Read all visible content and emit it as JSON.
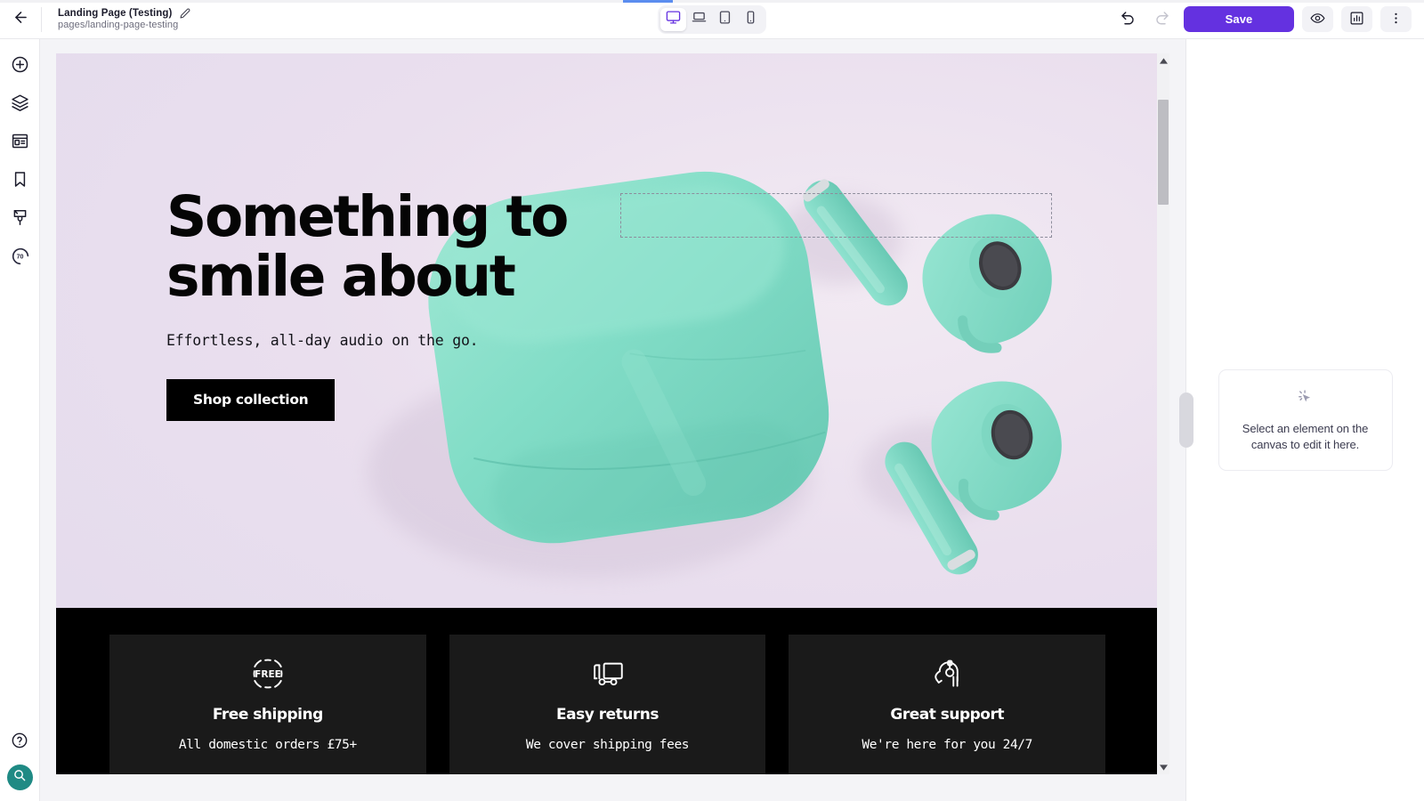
{
  "app": {
    "accent_purple": "#6431e0",
    "loadbar_color": "#5b8def",
    "teal_accent": "#1f8a84"
  },
  "topbar": {
    "back_icon": "arrow-left-icon",
    "page_title": "Landing Page (Testing)",
    "page_path": "pages/landing-page-testing",
    "edit_icon": "pencil-icon",
    "devices": [
      {
        "name": "desktop",
        "icon": "desktop-icon",
        "active": true
      },
      {
        "name": "laptop",
        "icon": "laptop-icon",
        "active": false
      },
      {
        "name": "tablet",
        "icon": "tablet-icon",
        "active": false
      },
      {
        "name": "mobile",
        "icon": "mobile-icon",
        "active": false
      }
    ],
    "undo_icon": "undo-icon",
    "redo_icon": "redo-icon",
    "save_label": "Save",
    "preview_icon": "eye-icon",
    "analytics_icon": "chart-icon",
    "more_icon": "more-vertical-icon"
  },
  "rail": {
    "items": [
      {
        "name": "add",
        "icon": "plus-circle-icon"
      },
      {
        "name": "layers",
        "icon": "layers-icon"
      },
      {
        "name": "sections",
        "icon": "template-icon"
      },
      {
        "name": "saved",
        "icon": "bookmark-icon"
      },
      {
        "name": "theme",
        "icon": "paint-brush-icon"
      },
      {
        "name": "score",
        "icon": "gauge-icon",
        "value": "70"
      }
    ],
    "help_icon": "help-circle-icon",
    "search_icon": "search-icon"
  },
  "canvas": {
    "hero": {
      "headline_line1": "Something to",
      "headline_line2": "smile about",
      "subtitle": "Effortless, all-day audio on the go.",
      "cta_label": "Shop collection",
      "background_color": "#ece2ee",
      "product_color": "#7fddc8",
      "drop_zone_label": "empty-drop-zone"
    },
    "features": [
      {
        "icon": "free-badge-icon",
        "icon_text": "FREE",
        "title": "Free shipping",
        "desc": "All domestic orders £75+"
      },
      {
        "icon": "delivery-truck-icon",
        "icon_text": "",
        "title": "Easy returns",
        "desc": "We cover shipping fees"
      },
      {
        "icon": "headset-support-icon",
        "icon_text": "",
        "title": "Great support",
        "desc": "We're here for you 24/7"
      }
    ],
    "scrollbar": {
      "up_icon": "caret-up-icon",
      "down_icon": "caret-down-icon"
    }
  },
  "right_panel": {
    "empty_icon": "cursor-click-icon",
    "empty_text": "Select an element on the canvas to edit it here.",
    "collapse_handle": "panel-collapse-handle"
  }
}
